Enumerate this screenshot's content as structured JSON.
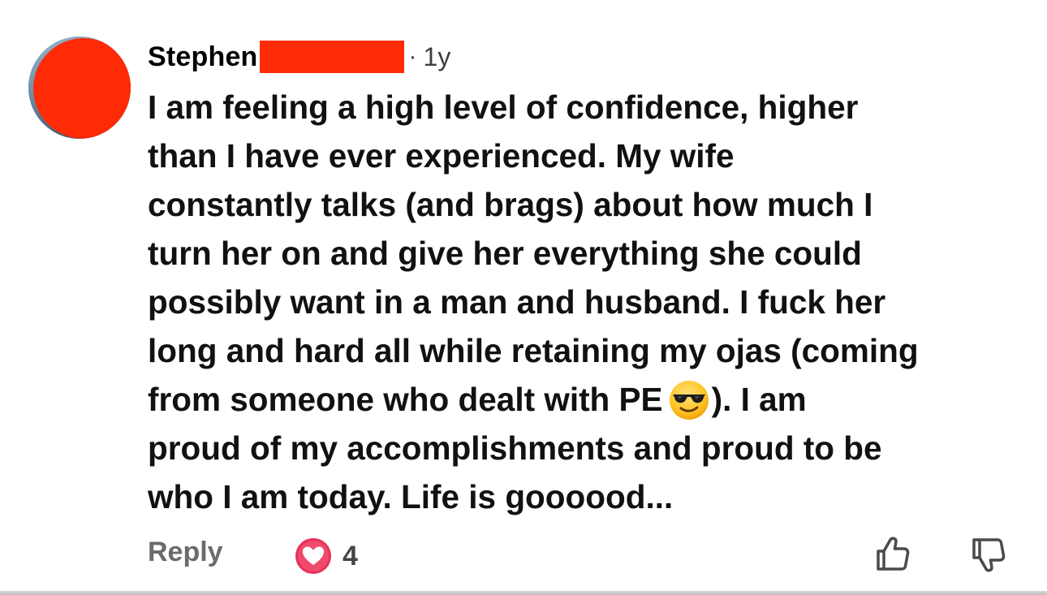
{
  "comment": {
    "author_name": "Stephen",
    "separator": "·",
    "timestamp": "1y",
    "body_lines": [
      "I am feeling a high level of confidence, higher",
      "than I have ever experienced.  My wife",
      "constantly talks (and brags) about how much I",
      "turn her on and give her everything she could",
      "possibly want in a man and husband.  I fuck her",
      "long and hard all while retaining my ojas (coming",
      "from someone who dealt with PE",
      ").  I am",
      "proud of my accomplishments and proud to be",
      "who I am today.  Life is goooood..."
    ],
    "emoji": "sunglasses-face-emoji",
    "reply_label": "Reply",
    "reaction": {
      "icon": "heart-icon",
      "count": "4"
    },
    "redaction_color": "#ff2a06"
  },
  "colors": {
    "text": "#111111",
    "muted": "#6b6b6b",
    "heart_ring": "#e8315a",
    "redaction": "#ff2a06"
  }
}
